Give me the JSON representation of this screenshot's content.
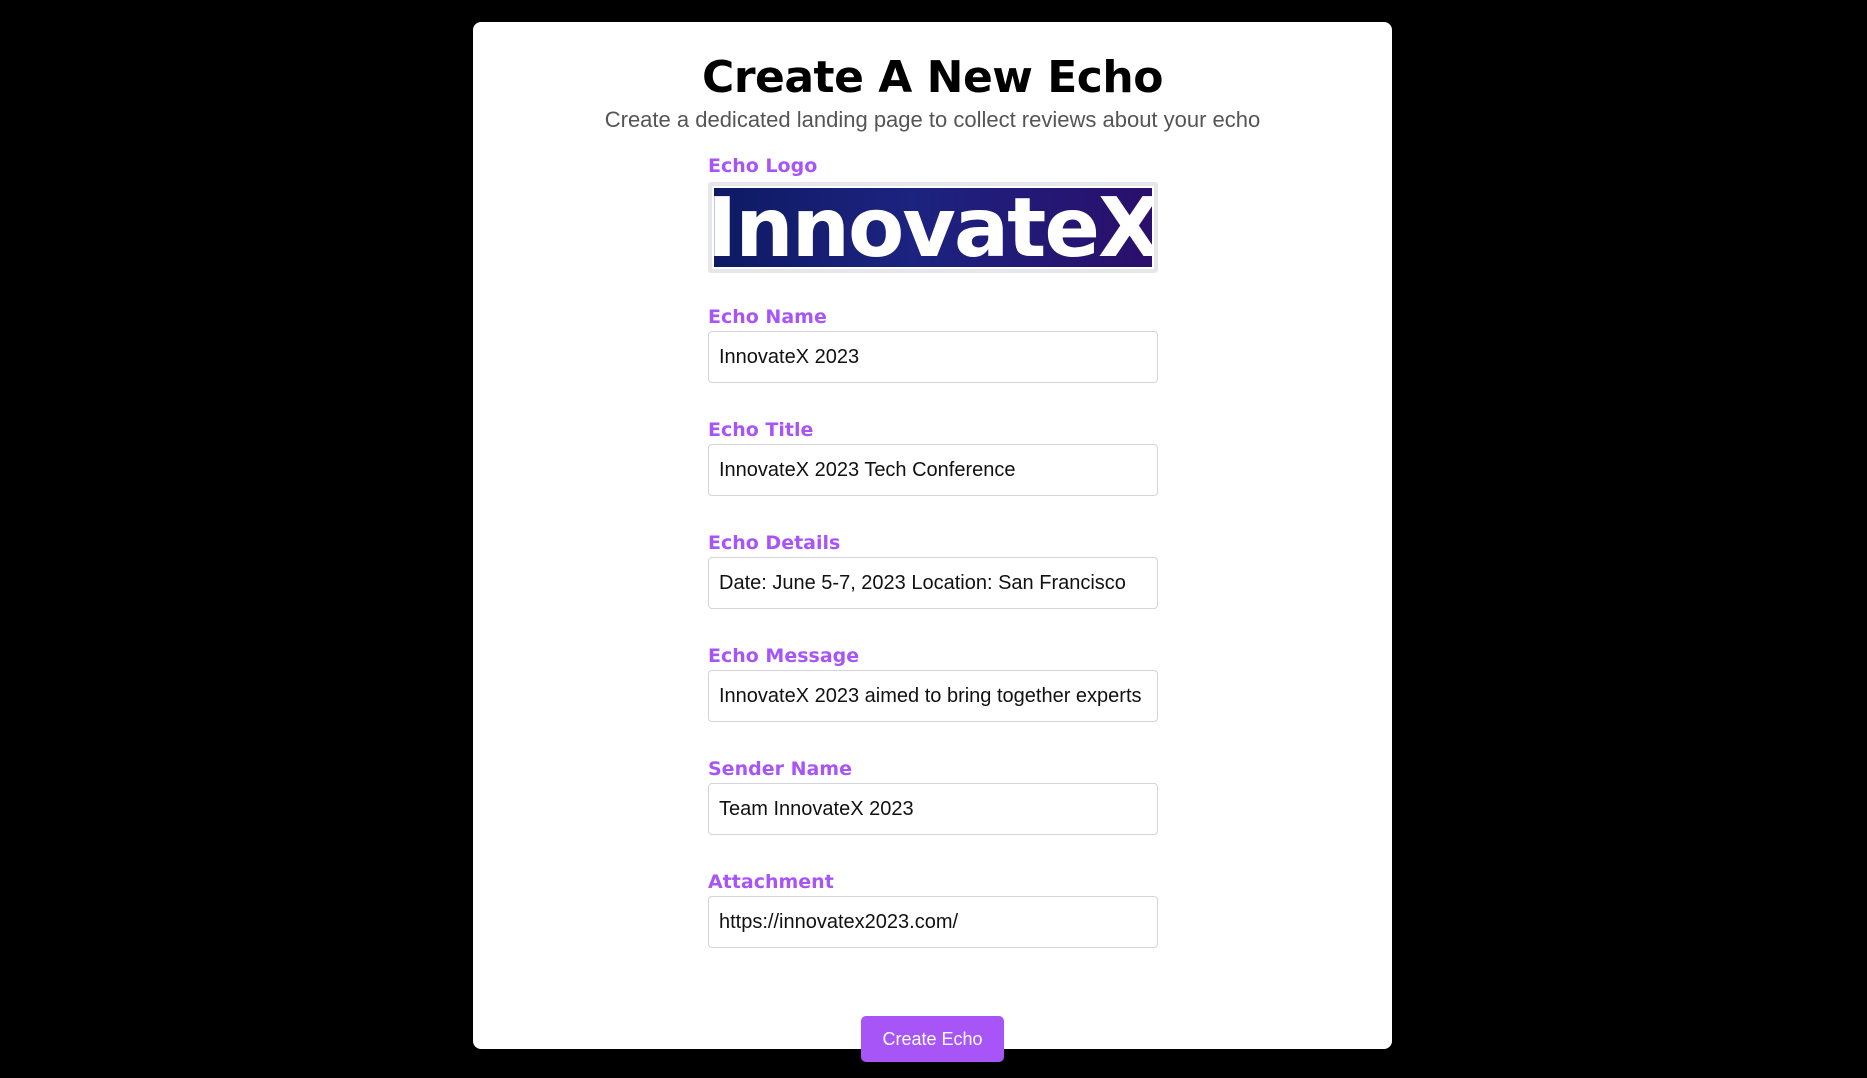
{
  "page": {
    "title": "Create A New Echo",
    "subtitle": "Create a dedicated landing page to collect reviews about your echo"
  },
  "form": {
    "logo": {
      "label": "Echo Logo",
      "logo_text": "InnovateX"
    },
    "fields": [
      {
        "label": "Echo Name",
        "value": "InnovateX 2023"
      },
      {
        "label": "Echo Title",
        "value": "InnovateX 2023 Tech Conference"
      },
      {
        "label": "Echo Details",
        "value": "Date: June 5-7, 2023 Location: San Francisco"
      },
      {
        "label": "Echo Message",
        "value": "InnovateX 2023 aimed to bring together experts"
      },
      {
        "label": "Sender Name",
        "value": "Team InnovateX 2023"
      },
      {
        "label": "Attachment",
        "value": "https://innovatex2023.com/"
      }
    ],
    "submit_label": "Create Echo"
  },
  "colors": {
    "accent": "#a855f7",
    "background": "#000000",
    "card": "#ffffff",
    "logo_gradient_start": "#0e1a63",
    "logo_gradient_end": "#2a0f6b"
  }
}
